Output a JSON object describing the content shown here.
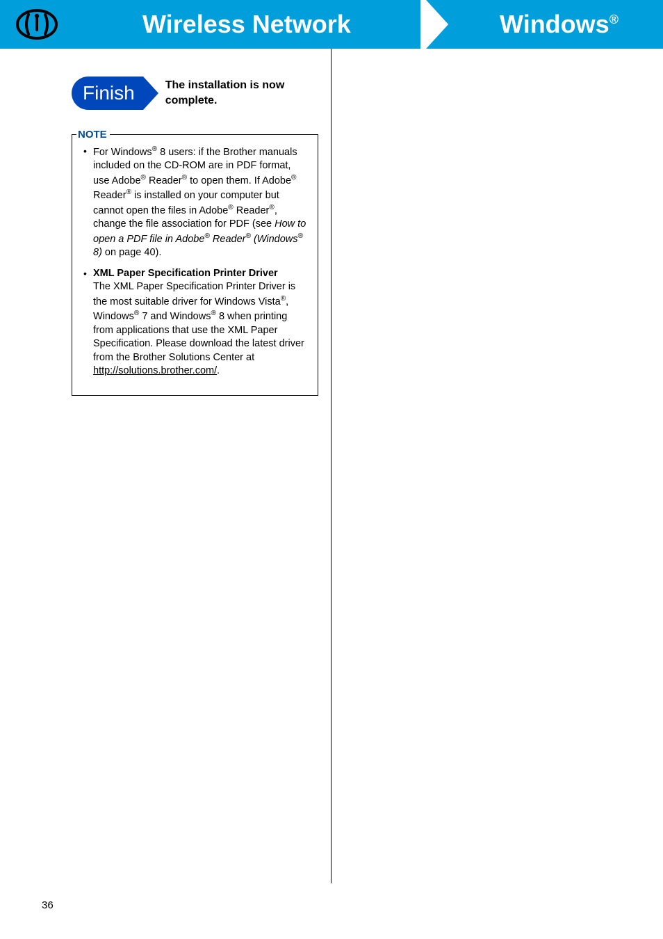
{
  "header": {
    "left_title": "Wireless Network",
    "right_title_base": "Windows",
    "right_title_mark": "®"
  },
  "finish": {
    "badge": "Finish",
    "text": "The installation is now complete."
  },
  "note": {
    "label": "NOTE",
    "bullet1": {
      "pre1": "For Windows",
      "r1": "®",
      "t2": " 8 users: if the Brother manuals included on the CD-ROM are in PDF format, use Adobe",
      "r2": "®",
      "t3": " Reader",
      "r3": "®",
      "t4": " to open them. If Adobe",
      "r4": "®",
      "t5": " Reader",
      "r5": "®",
      "t6": " is installed on your computer but cannot open the files in Adobe",
      "r6": "®",
      "t7": " Reader",
      "r7": "®",
      "t8": ", change the file association for PDF (see ",
      "italic_a": "How to open a PDF file in Adobe",
      "ir1": "®",
      "italic_b": " Reader",
      "ir2": "®",
      "italic_c": " (Windows",
      "ir3": "®",
      "italic_d": " 8)",
      "tail": " on page 40)."
    },
    "bullet2": {
      "title": "XML Paper Specification Printer Driver",
      "t1": "The XML Paper Specification Printer Driver is the most suitable driver for Windows Vista",
      "r1": "®",
      "t2": ", Windows",
      "r2": "®",
      "t3": " 7 and Windows",
      "r3": "®",
      "t4": " 8 when printing from applications that use the XML Paper Specification. Please download the latest driver from the Brother Solutions Center at ",
      "link": "http://solutions.brother.com/",
      "tail": "."
    }
  },
  "page_number": "36"
}
